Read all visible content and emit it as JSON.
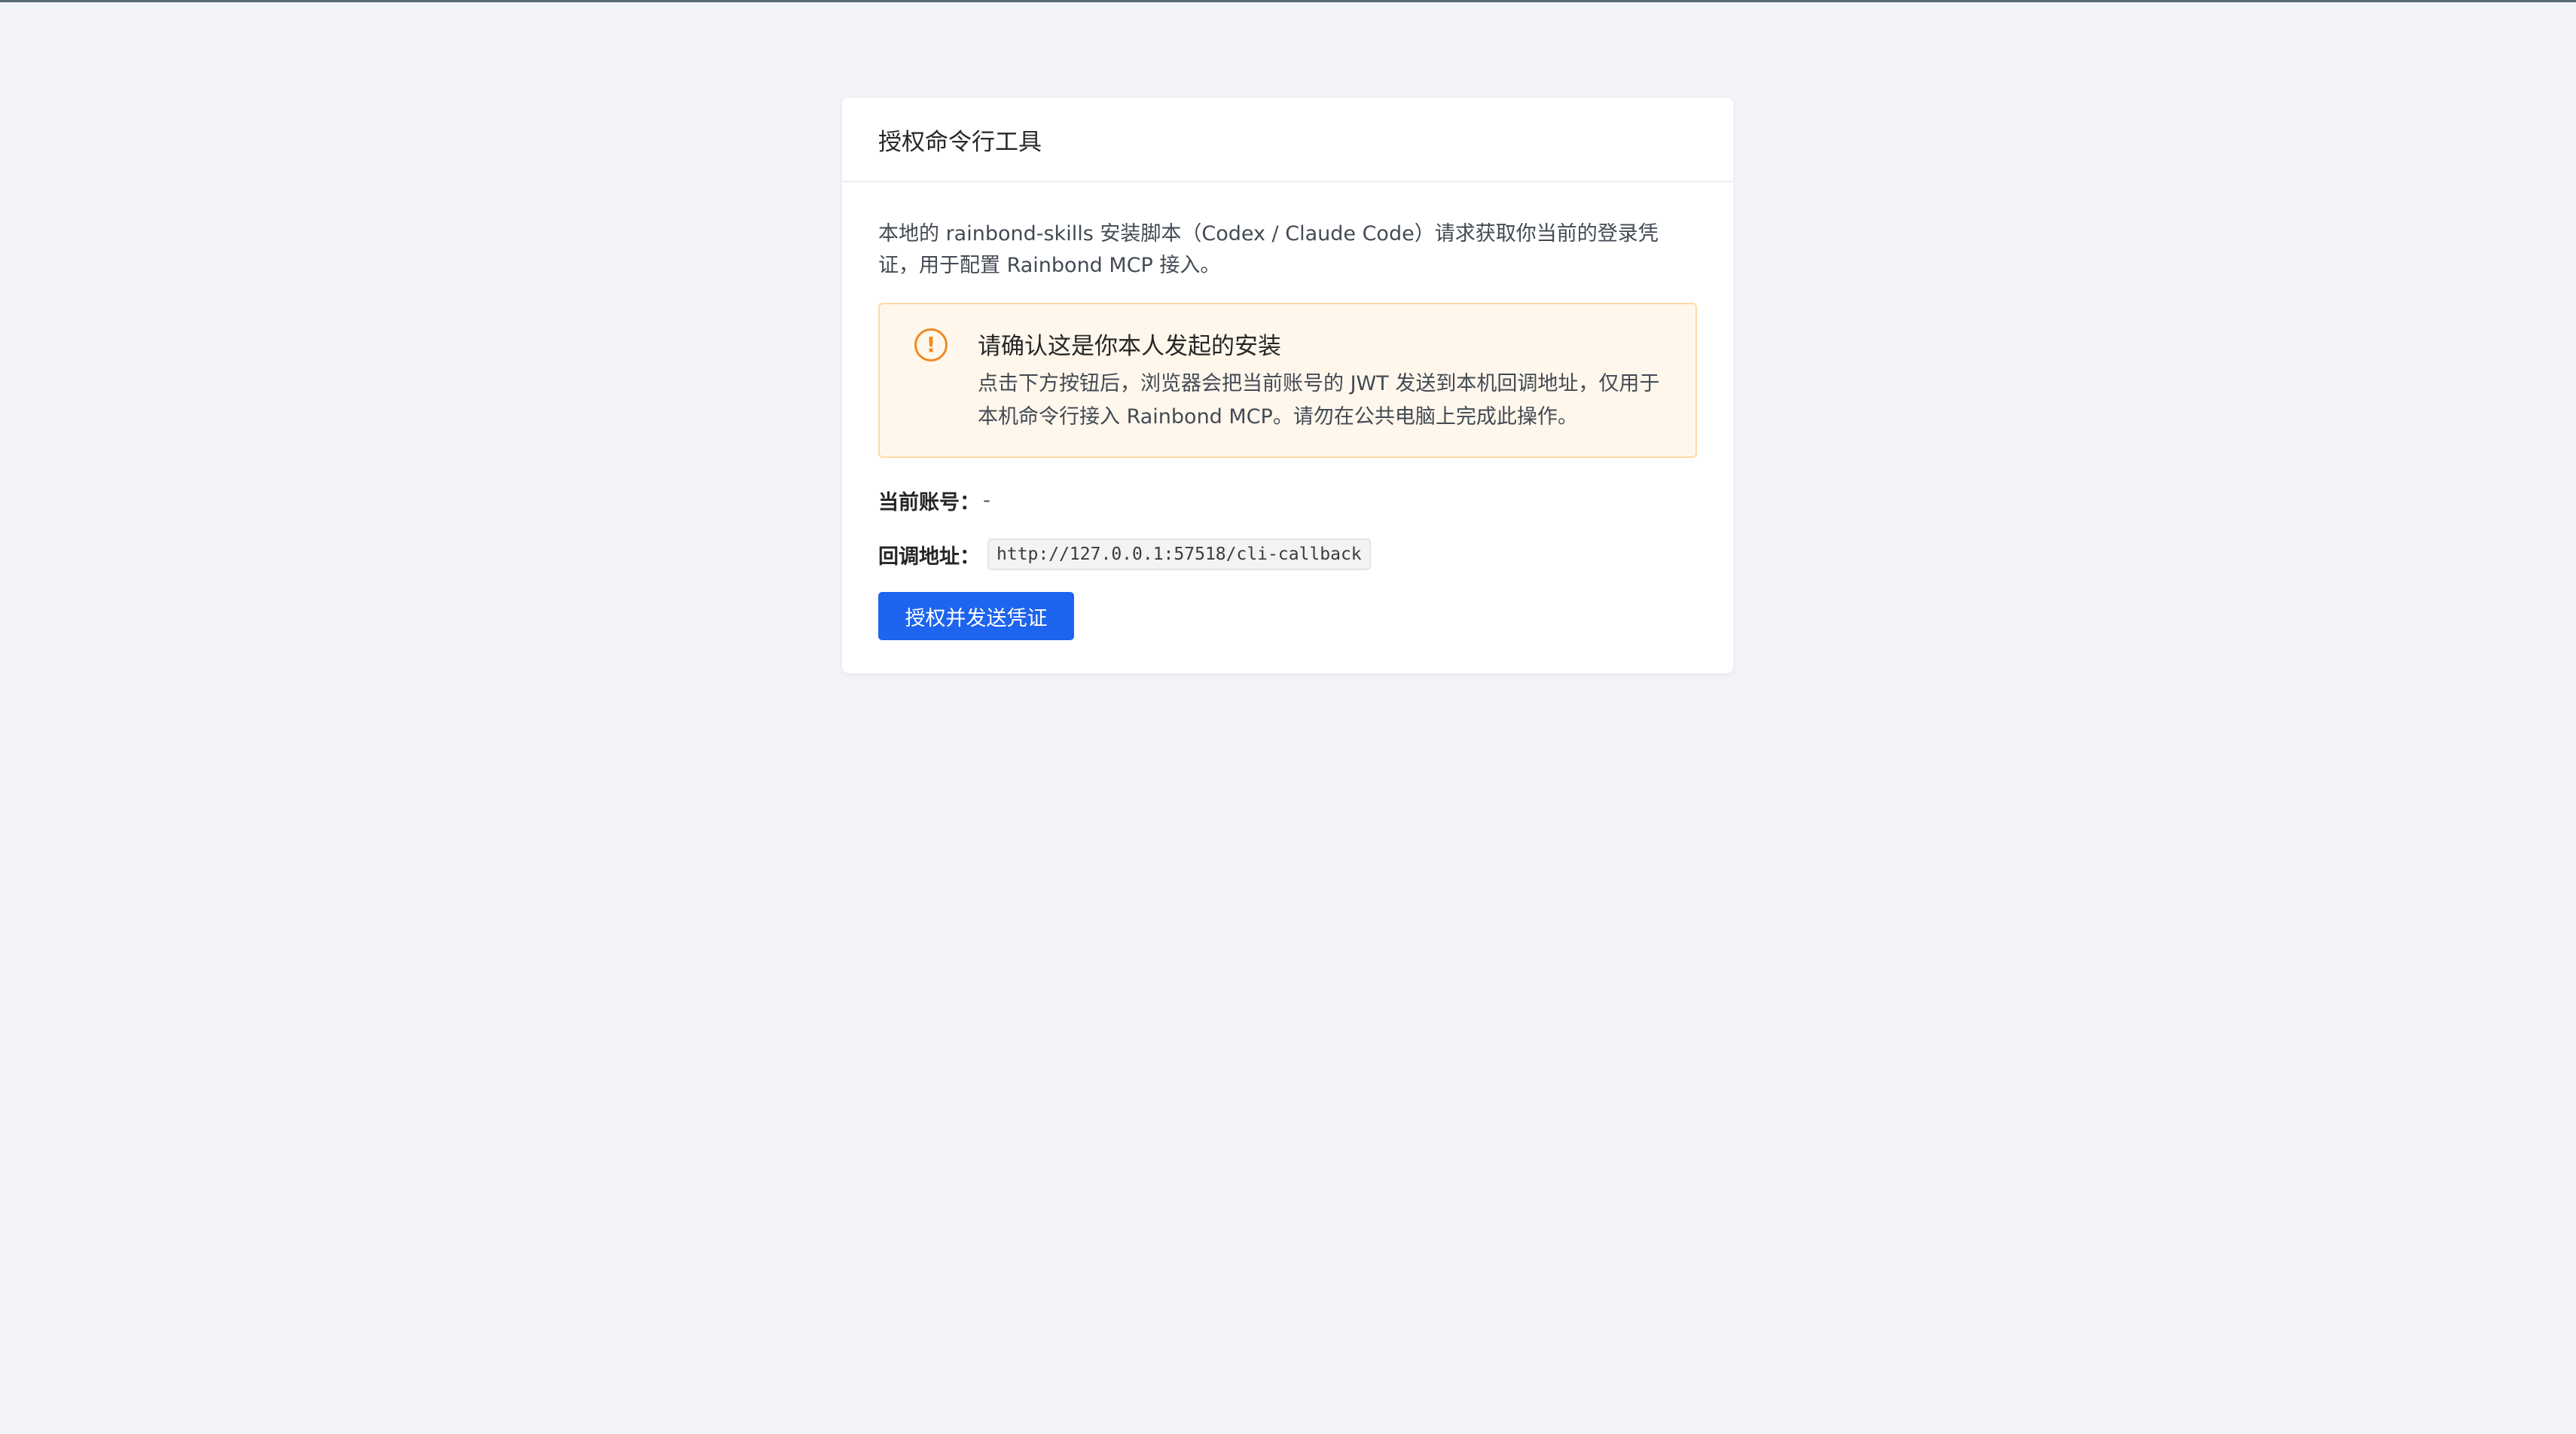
{
  "card": {
    "title": "授权命令行工具",
    "description": "本地的 rainbond-skills 安装脚本（Codex / Claude Code）请求获取你当前的登录凭证，用于配置 Rainbond MCP 接入。"
  },
  "alert": {
    "icon": "exclamation-circle-icon",
    "title": "请确认这是你本人发起的安装",
    "text": "点击下方按钮后，浏览器会把当前账号的 JWT 发送到本机回调地址，仅用于本机命令行接入 Rainbond MCP。请勿在公共电脑上完成此操作。"
  },
  "account": {
    "label": "当前账号：",
    "value": "-"
  },
  "callback": {
    "label": "回调地址：",
    "value": "http://127.0.0.1:57518/cli-callback"
  },
  "actions": {
    "authorize_label": "授权并发送凭证"
  },
  "colors": {
    "primary": "#1d64ee",
    "warning": "#f08a24",
    "warning_bg": "#fff7ec",
    "page_bg": "#f2f4f7"
  }
}
